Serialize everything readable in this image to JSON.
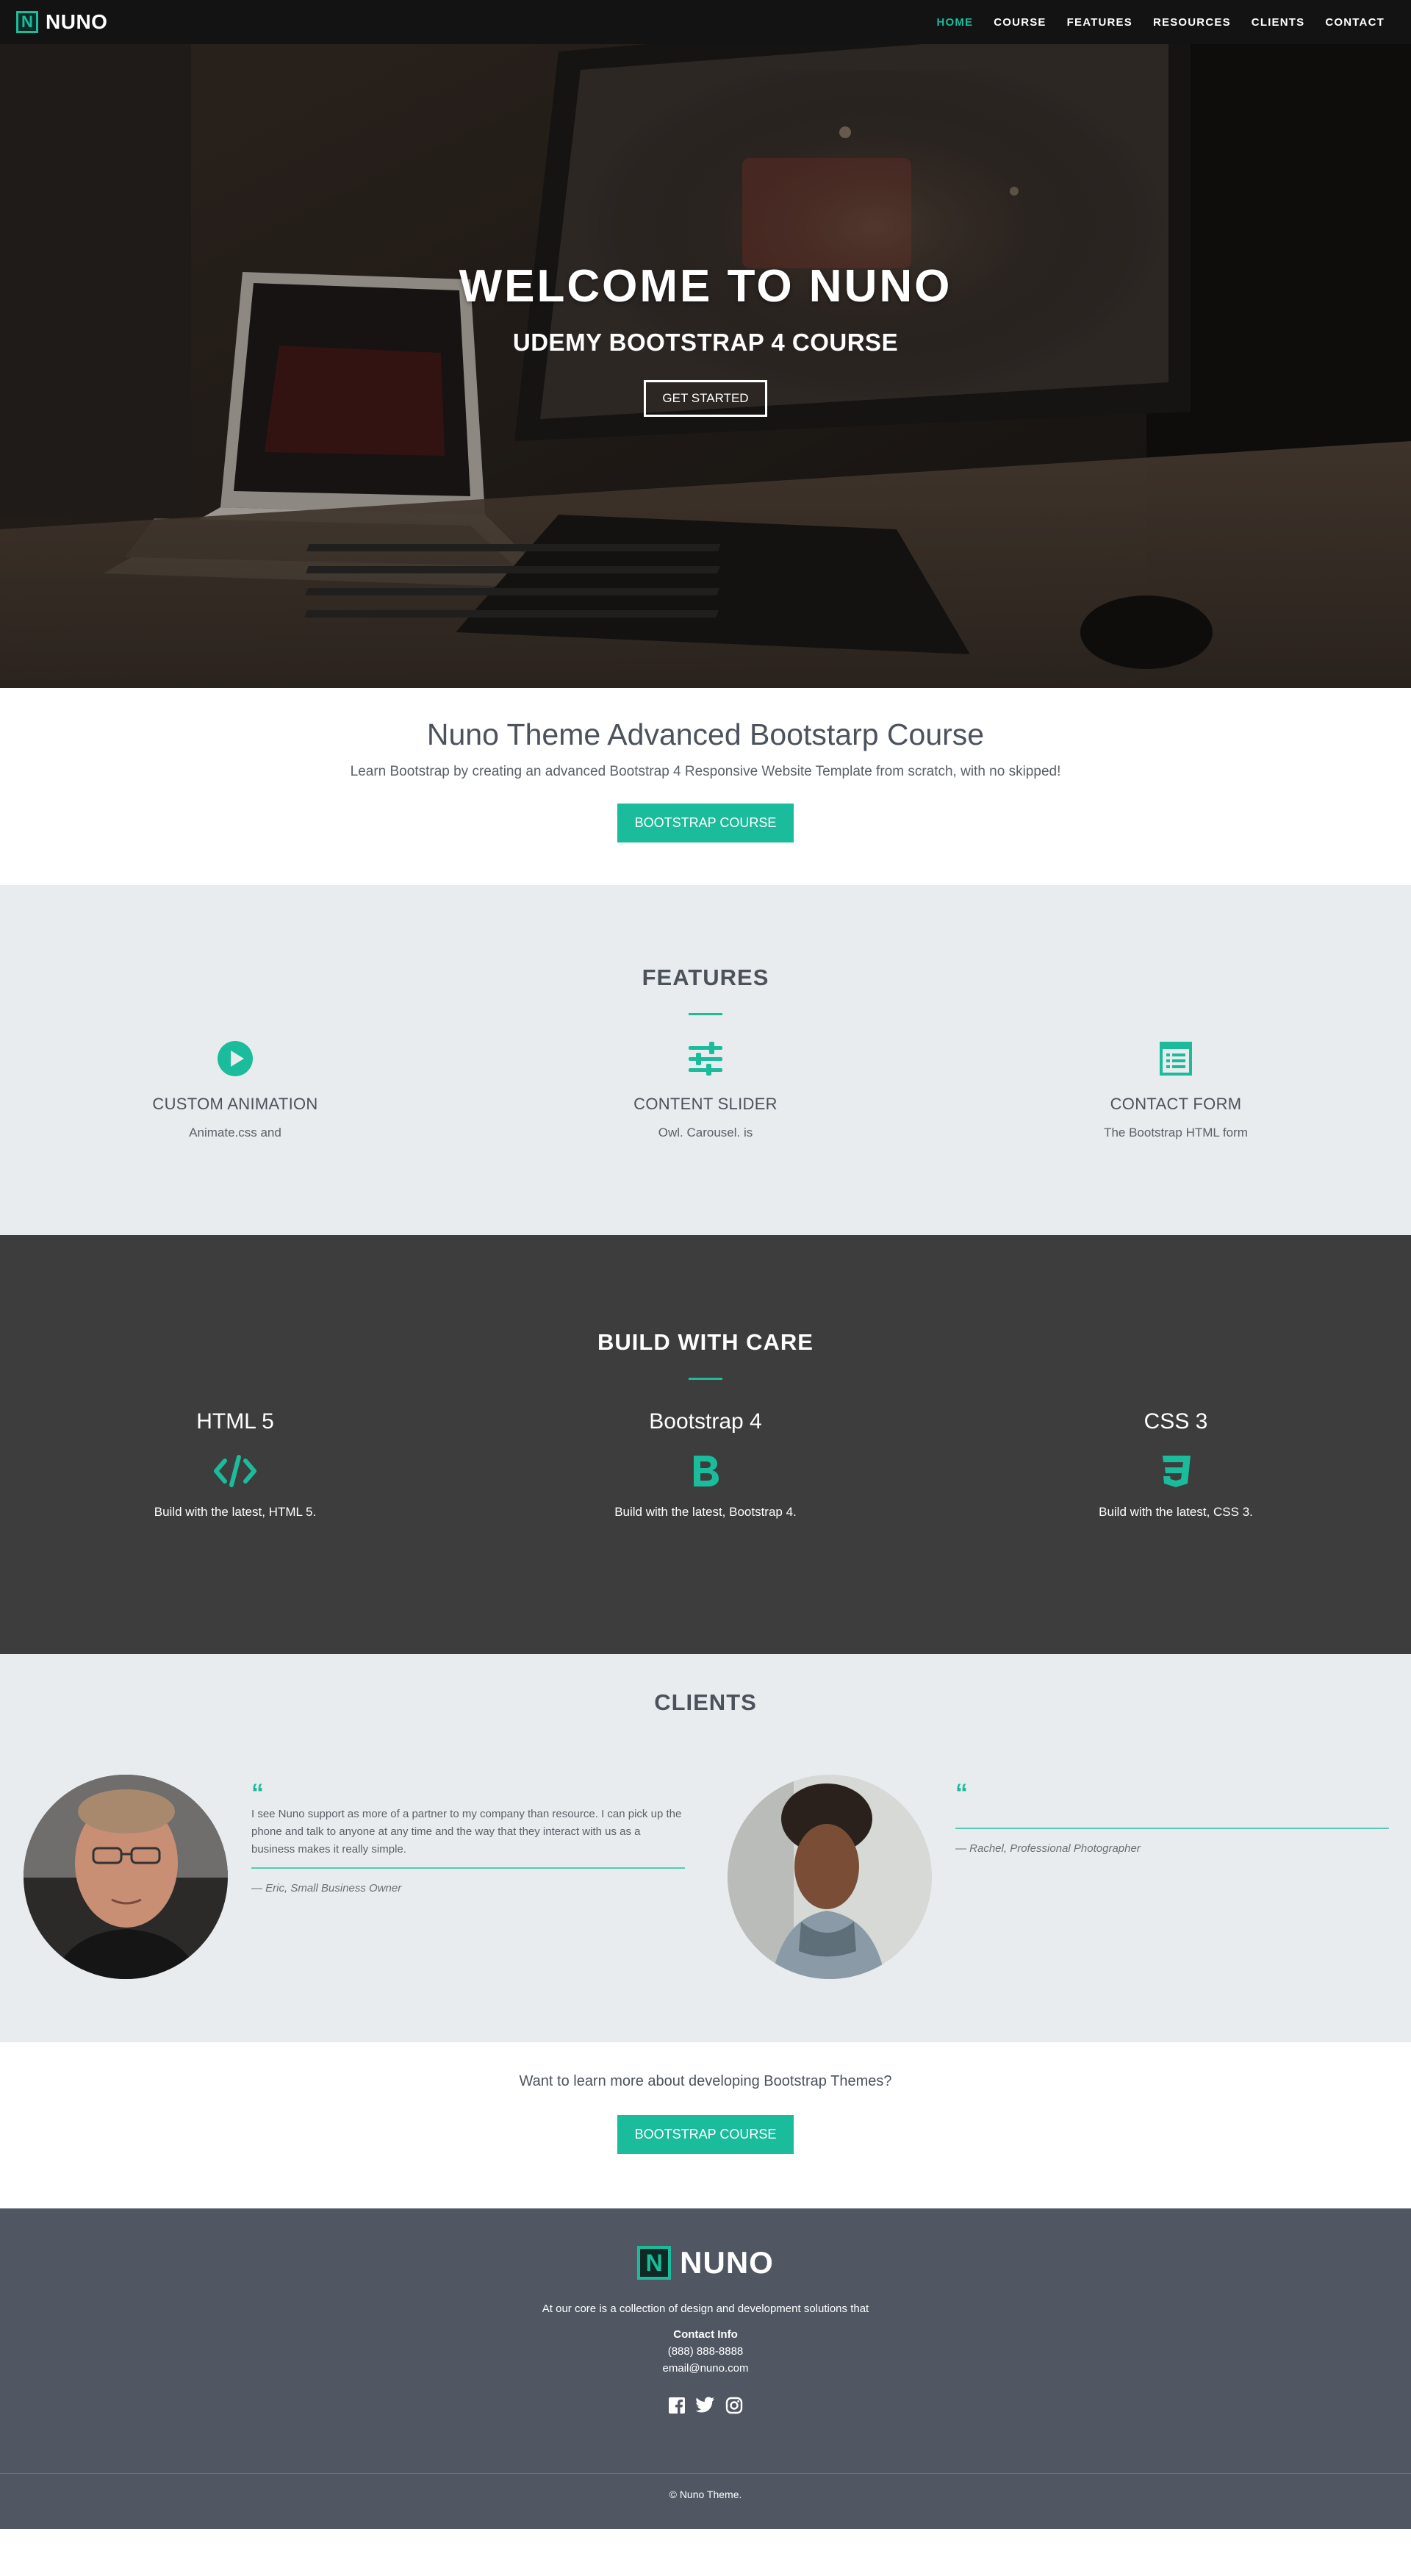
{
  "navbar": {
    "brand_letter": "N",
    "brand": "NUNO",
    "links": [
      "HOME",
      "COURSE",
      "FEATURES",
      "RESOURCES",
      "CLIENTS",
      "CONTACT"
    ],
    "active": "HOME"
  },
  "hero": {
    "title": "WELCOME TO NUNO",
    "subtitle": "UDEMY BOOTSTRAP 4 COURSE",
    "button": "GET STARTED"
  },
  "intro": {
    "title": "Nuno Theme Advanced Bootstarp Course",
    "text": "Learn Bootstrap by creating an advanced Bootstrap 4 Responsive Website Template from scratch, with no skipped!",
    "button": "BOOTSTRAP COURSE"
  },
  "features": {
    "title": "FEATURES",
    "items": [
      {
        "icon": "play-circle-icon",
        "title": "CUSTOM ANIMATION",
        "text": "Animate.css and"
      },
      {
        "icon": "sliders-icon",
        "title": "CONTENT SLIDER",
        "text": "Owl. Carousel. is"
      },
      {
        "icon": "form-icon",
        "title": "CONTACT FORM",
        "text": "The Bootstrap HTML form"
      }
    ]
  },
  "build": {
    "title": "BUILD WITH CARE",
    "items": [
      {
        "title": "HTML 5",
        "icon": "code-icon",
        "text": "Build with the latest, HTML 5."
      },
      {
        "title": "Bootstrap 4",
        "icon": "bootstrap-icon",
        "text": "Build with the latest, Bootstrap 4."
      },
      {
        "title": "CSS 3",
        "icon": "css3-icon",
        "text": "Build with the latest, CSS 3."
      }
    ]
  },
  "clients": {
    "title": "CLIENTS",
    "testimonials": [
      {
        "quote": "I see Nuno support as more of a partner to my company than resource. I can pick up the phone and talk to anyone at any time and the way that they interact with us as a business makes it really simple.",
        "cite": "— Eric, Small Business Owner"
      },
      {
        "quote": "",
        "cite": "— Rachel, Professional Photographer"
      }
    ]
  },
  "cta": {
    "text": "Want to learn more about developing Bootstrap Themes?",
    "button": "BOOTSTRAP COURSE"
  },
  "footer": {
    "brand_letter": "N",
    "brand": "NUNO",
    "text": "At our core is a collection of design and development solutions that",
    "contact_title": "Contact Info",
    "phone": "(888) 888-8888",
    "email": "email@nuno.com",
    "social": [
      "facebook-icon",
      "twitter-icon",
      "instagram-icon"
    ],
    "copyright": "© Nuno Theme."
  },
  "colors": {
    "accent": "#1abc9c",
    "nav_bg": "#141313",
    "features_bg": "#e9ecef",
    "build_bg": "#3d3d3d",
    "footer_bg": "#505763"
  }
}
